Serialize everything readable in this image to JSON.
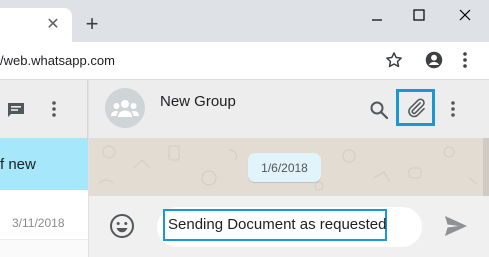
{
  "browser": {
    "tab_close_glyph": "✕",
    "new_tab_glyph": "+",
    "url": "/web.whatsapp.com"
  },
  "sidebar": {
    "active_chat_label": "f new",
    "chat_item_date": "3/11/2018"
  },
  "conversation": {
    "title": "New Group",
    "date_divider": "1/6/2018"
  },
  "compose": {
    "message_text": "Sending Document as requested"
  },
  "colors": {
    "highlight": "#1a97d6",
    "active_chat_bg": "#a6e7fb",
    "header_bg": "#ededed",
    "chat_bg": "#e3dcd3"
  },
  "icons": [
    "close-icon",
    "plus-icon",
    "minimize-icon",
    "maximize-icon",
    "window-close-icon",
    "star-icon",
    "account-icon",
    "kebab-menu-icon",
    "chat-icon",
    "group-avatar-icon",
    "search-icon",
    "paperclip-icon",
    "emoji-icon",
    "send-icon"
  ]
}
